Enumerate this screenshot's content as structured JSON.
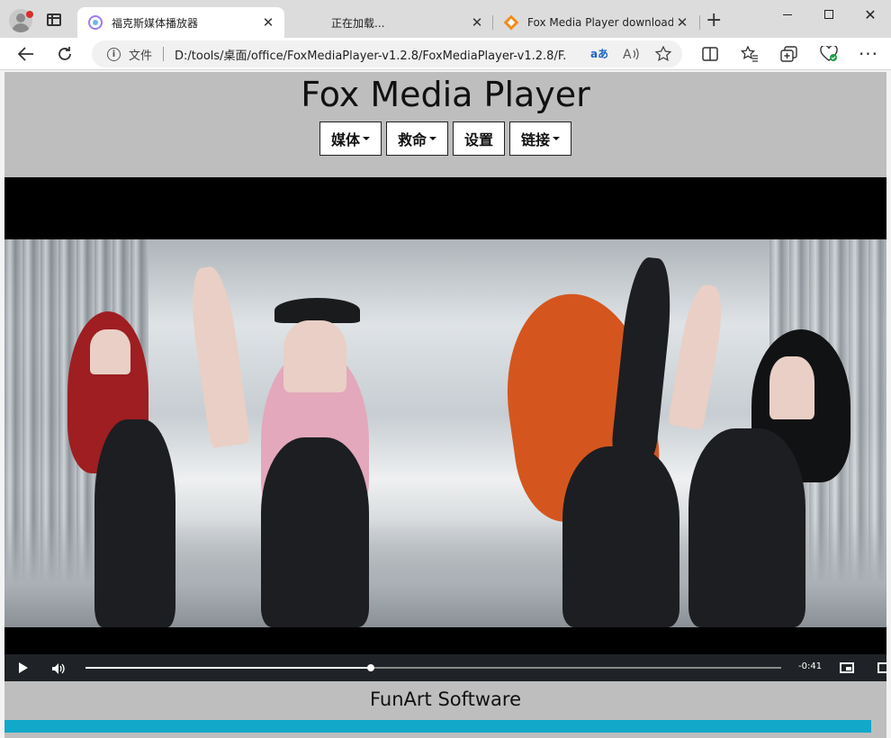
{
  "browser": {
    "tabs": [
      {
        "title": "福克斯媒体播放器",
        "active": true,
        "favicon": "app-circle-icon"
      },
      {
        "title": "正在加载...",
        "active": false,
        "favicon": "loading-icon"
      },
      {
        "title": "Fox Media Player download | So",
        "active": false,
        "favicon": "diamond-icon"
      }
    ],
    "address": {
      "scheme_label": "文件",
      "url": "D:/tools/桌面/office/FoxMediaPlayer-v1.2.8/FoxMediaPlayer-v1.2.8/F..."
    },
    "accent_color": "#1a66cc"
  },
  "app": {
    "title": "Fox Media Player",
    "menu": [
      {
        "label": "媒体",
        "dropdown": true
      },
      {
        "label": "救命",
        "dropdown": true
      },
      {
        "label": "设置",
        "dropdown": false
      },
      {
        "label": "链接",
        "dropdown": true
      }
    ],
    "player": {
      "time_remaining": "-0:41",
      "progress": 0.41
    },
    "footer": "FunArt Software",
    "footer_bar_color": "#11a8c9"
  }
}
